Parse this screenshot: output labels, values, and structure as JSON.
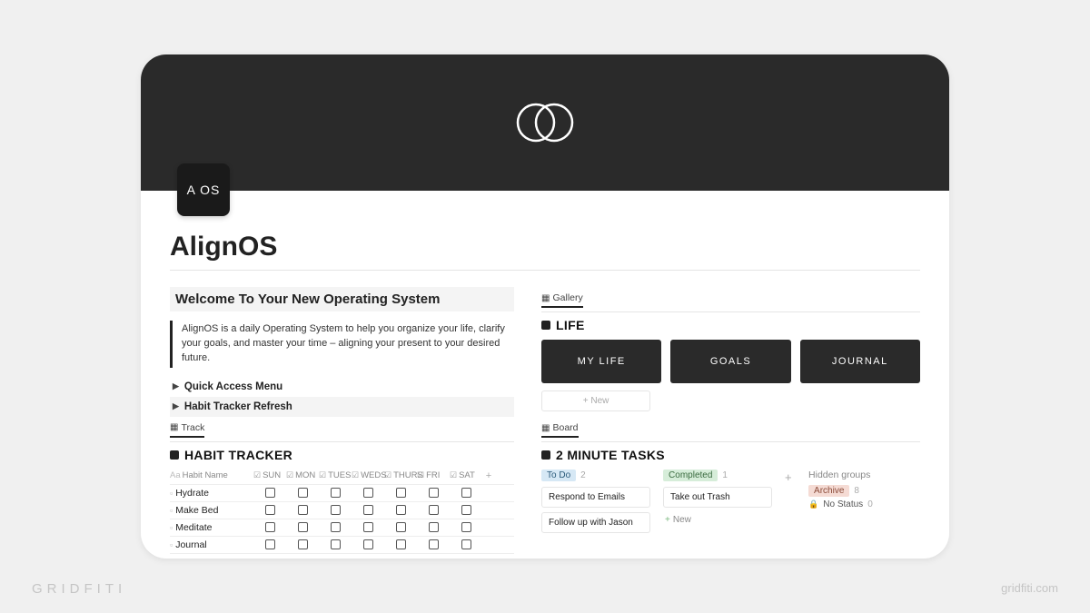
{
  "page": {
    "icon_label": "A OS",
    "title": "AlignOS"
  },
  "left": {
    "welcome": "Welcome To Your New Operating System",
    "description": "AlignOS is a daily Operating System to help you organize your life, clarify your goals, and master your time – aligning your present to your desired future.",
    "toggles": [
      "Quick Access Menu",
      "Habit Tracker Refresh"
    ],
    "track_view": "Track",
    "habit_tracker": {
      "title": "HABIT TRACKER",
      "name_col": "Habit Name",
      "days": [
        "SUN",
        "MON",
        "TUES",
        "WEDS",
        "THURS",
        "FRI",
        "SAT"
      ],
      "rows": [
        "Hydrate",
        "Make Bed",
        "Meditate",
        "Journal"
      ]
    }
  },
  "right": {
    "gallery_view": "Gallery",
    "life": {
      "title": "LIFE",
      "cards": [
        "MY LIFE",
        "GOALS",
        "JOURNAL"
      ],
      "new_label": "+ New"
    },
    "board_view": "Board",
    "tasks": {
      "title": "2 MINUTE TASKS",
      "columns": [
        {
          "label": "To Do",
          "tag": "todo",
          "count": 2,
          "cards": [
            "Respond to Emails",
            "Follow up with Jason"
          ]
        },
        {
          "label": "Completed",
          "tag": "done",
          "count": 1,
          "cards": [
            "Take out Trash"
          ],
          "new": "New"
        }
      ],
      "hidden": {
        "title": "Hidden groups",
        "items": [
          {
            "label": "Archive",
            "tag": "archive",
            "count": 8
          },
          {
            "label": "No Status",
            "tag": "none",
            "count": 0
          }
        ]
      }
    }
  },
  "watermark": {
    "left": "GRIDFITI",
    "right": "gridfiti.com"
  }
}
